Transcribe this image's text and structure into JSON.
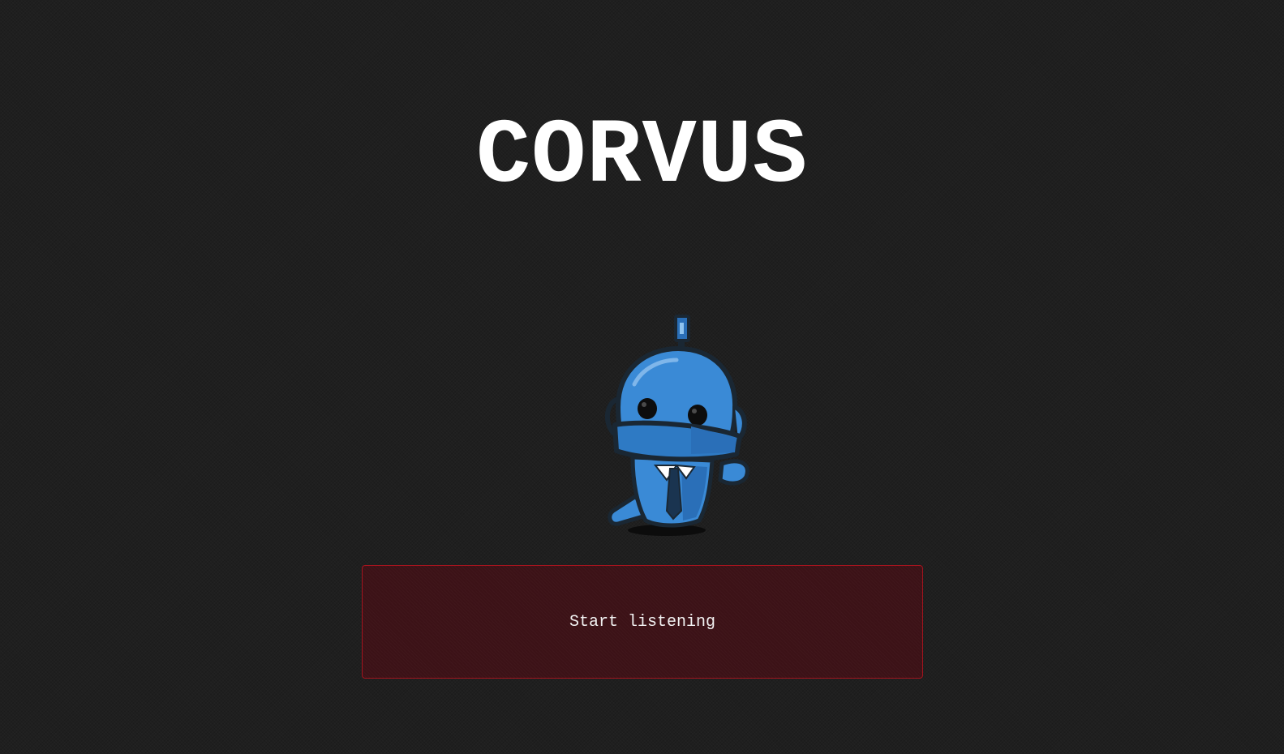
{
  "app": {
    "title": "CORVUS"
  },
  "mascot": {
    "icon": "robot-mascot-icon",
    "colors": {
      "body": "#3a8ad6",
      "body_shadow": "#2a6fb8",
      "outline": "#1a2733",
      "face_band": "#2e7ac4"
    }
  },
  "listen_button": {
    "label": "Start listening"
  },
  "colors": {
    "background": "#1f1f1f",
    "title_text": "#ffffff",
    "button_background": "#3c1217",
    "button_border": "#a4141e",
    "button_text": "#f2f2f2"
  }
}
